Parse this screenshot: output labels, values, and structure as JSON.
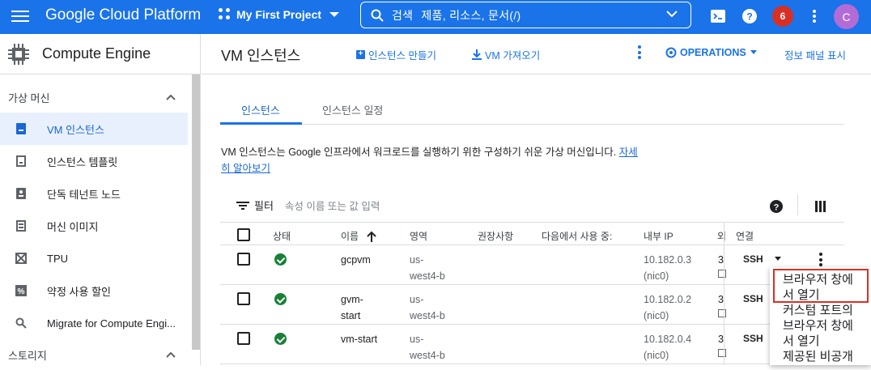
{
  "topbar": {
    "brand": "Google Cloud Platform",
    "project": "My First Project",
    "search_label": "검색",
    "search_query": "제품, 리소스, 문서(/)",
    "notification_count": "6",
    "avatar_initial": "C",
    "color": "#1a73e8"
  },
  "sidebar": {
    "product": "Compute Engine",
    "section1": "가상 머신",
    "items": [
      {
        "label": "VM 인스턴스",
        "icon": "vm-instance-icon"
      },
      {
        "label": "인스턴스 템플릿",
        "icon": "template-icon"
      },
      {
        "label": "단독 테넌트 노드",
        "icon": "sole-tenant-icon"
      },
      {
        "label": "머신 이미지",
        "icon": "machine-image-icon"
      },
      {
        "label": "TPU",
        "icon": "tpu-icon"
      },
      {
        "label": "약정 사용 할인",
        "icon": "percent-icon"
      },
      {
        "label": "Migrate for Compute Engi...",
        "icon": "search-icon"
      }
    ],
    "section2": "스토리지"
  },
  "header": {
    "title": "VM 인스턴스",
    "create": "인스턴스 만들기",
    "import": "VM 가져오기",
    "operations": "OPERATIONS",
    "info_panel": "정보 패널 표시"
  },
  "tabs": [
    "인스턴스",
    "인스턴스 일정"
  ],
  "description": {
    "text": "VM 인스턴스는 Google 인프라에서 워크로드를 실행하기 위한 구성하기 쉬운 가상 머신입니다.",
    "link": "자세히 알아보기"
  },
  "filter": {
    "label": "필터",
    "placeholder": "속성 이름 또는 값 입력"
  },
  "table": {
    "headers": [
      "상태",
      "이름",
      "영역",
      "권장사항",
      "다음에서 사용 중:",
      "내부 IP",
      "외",
      "연결"
    ],
    "rows": [
      {
        "name1": "gcpvm",
        "name2": "",
        "zone1": "us-",
        "zone2": "west4-b",
        "ip1": "10.182.0.3",
        "ip2": "(nic0)",
        "ext": "3",
        "conn": "SSH"
      },
      {
        "name1": "gvm-",
        "name2": "start",
        "zone1": "us-",
        "zone2": "west4-b",
        "ip1": "10.182.0.2",
        "ip2": "(nic0)",
        "ext": "3",
        "conn": "SSH"
      },
      {
        "name1": "vm-start",
        "name2": "",
        "zone1": "us-",
        "zone2": "west4-b",
        "ip1": "10.182.0.4",
        "ip2": "(nic0)",
        "ext": "3",
        "conn": "SSH"
      }
    ]
  },
  "ssh_menu": {
    "items": [
      "브라우저 창에",
      "서 열기",
      "커스텀 포트의",
      "브라우저 창에",
      "서 열기",
      "제공된 비공개"
    ]
  }
}
